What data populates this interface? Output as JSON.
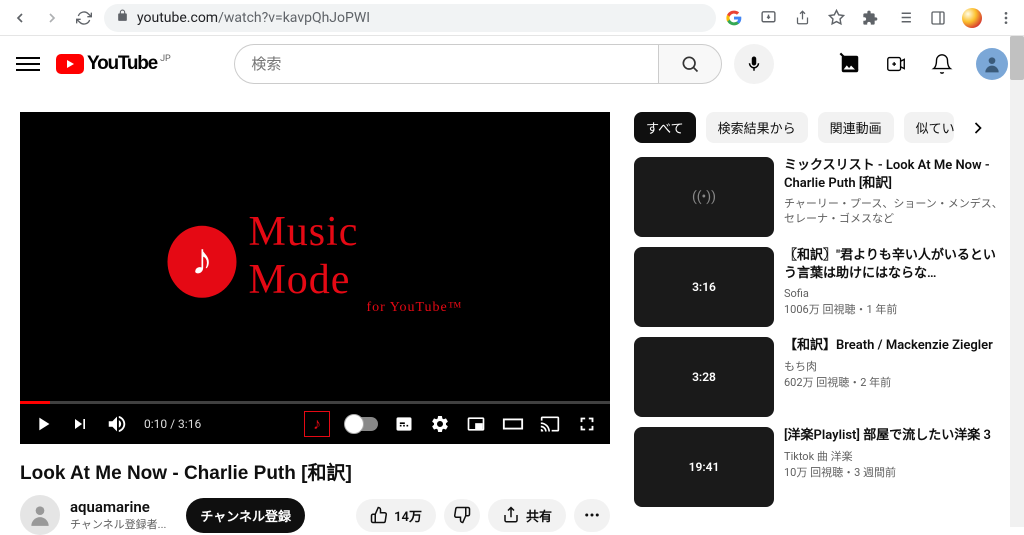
{
  "browser": {
    "url_host": "youtube.com",
    "url_path": "/watch?v=kavpQhJoPWI"
  },
  "header": {
    "logo_text": "YouTube",
    "country": "JP",
    "search_placeholder": "検索"
  },
  "player": {
    "mm_title": "Music Mode",
    "mm_sub": "for YouTube™",
    "time": "0:10 / 3:16"
  },
  "video": {
    "title": "Look At Me Now - Charlie Puth [和訳]",
    "channel": "aquamarine",
    "sub_count": "チャンネル登録者...",
    "subscribe": "チャンネル登録",
    "likes": "14万",
    "share": "共有"
  },
  "chips": [
    "すべて",
    "検索結果から",
    "関連動画",
    "似ている"
  ],
  "recs": [
    {
      "title": "ミックスリスト - Look At Me Now - Charlie Puth [和訳]",
      "channel": "チャーリー・プース、ショーン・メンデス、セレーナ・ゴメスなど",
      "meta": "",
      "duration": "",
      "mix": true
    },
    {
      "title": "〖和訳〗\"君よりも辛い人がいるという言葉は助けにはならな…",
      "channel": "Sofia",
      "meta": "1006万 回視聴・1 年前",
      "duration": "3:16",
      "mix": false
    },
    {
      "title": "【和訳】Breath / Mackenzie Ziegler",
      "channel": "もち肉",
      "meta": "602万 回視聴・2 年前",
      "duration": "3:28",
      "mix": false
    },
    {
      "title": "[洋楽Playlist] 部屋で流したい洋楽 3",
      "channel": "Tiktok 曲 洋楽",
      "meta": "10万 回視聴・3 週間前",
      "duration": "19:41",
      "mix": false
    }
  ]
}
